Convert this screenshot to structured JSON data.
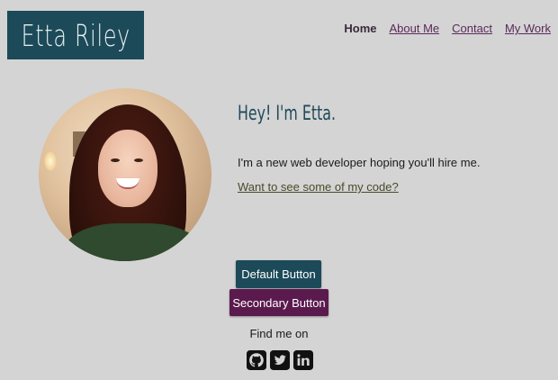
{
  "site": {
    "logo_text": "Etta Riley"
  },
  "nav": {
    "items": [
      {
        "label": "Home"
      },
      {
        "label": "About Me"
      },
      {
        "label": "Contact"
      },
      {
        "label": "My Work"
      }
    ]
  },
  "hero": {
    "greeting": "Hey! I'm Etta.",
    "intro": "I'm a new web developer hoping you'll hire me.",
    "code_link": "Want to see some of my code?"
  },
  "buttons": {
    "default_label": "Default Button",
    "secondary_label": "Secondary Button"
  },
  "social": {
    "find_label": "Find me on",
    "icons": [
      "github-icon",
      "twitter-icon",
      "linkedin-icon"
    ]
  },
  "colors": {
    "background": "#d4d4d4",
    "primary": "#1c4a59",
    "secondary": "#5b1a4d",
    "nav_link": "#5a2a5a"
  }
}
